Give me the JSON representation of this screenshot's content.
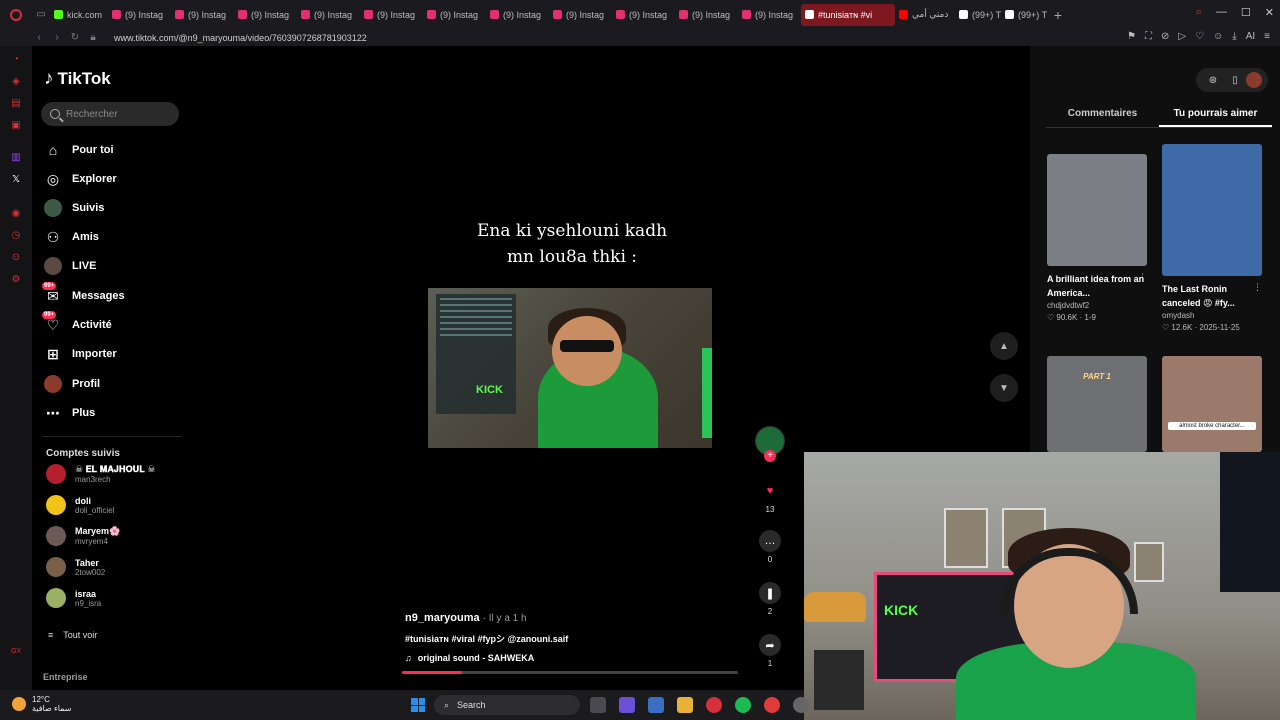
{
  "browser": {
    "tabs": [
      {
        "label": "kick.com",
        "color": "#53fc18",
        "type": "kick"
      },
      {
        "label": "(9) Instag",
        "color": "#e1306c",
        "type": "ig"
      },
      {
        "label": "(9) Instag",
        "color": "#e1306c",
        "type": "ig"
      },
      {
        "label": "(9) Instag",
        "color": "#e1306c",
        "type": "ig"
      },
      {
        "label": "(9) Instag",
        "color": "#e1306c",
        "type": "ig"
      },
      {
        "label": "(9) Instag",
        "color": "#e1306c",
        "type": "ig"
      },
      {
        "label": "(9) Instag",
        "color": "#e1306c",
        "type": "ig"
      },
      {
        "label": "(9) Instag",
        "color": "#e1306c",
        "type": "ig"
      },
      {
        "label": "(9) Instag",
        "color": "#e1306c",
        "type": "ig"
      },
      {
        "label": "(9) Instag",
        "color": "#e1306c",
        "type": "ig"
      },
      {
        "label": "(9) Instag",
        "color": "#e1306c",
        "type": "ig"
      },
      {
        "label": "(9) Instag",
        "color": "#e1306c",
        "type": "ig"
      },
      {
        "label": "#tunisiaᴛɴ #vi",
        "color": "#ffffff",
        "type": "active"
      },
      {
        "label": "دمتي أمي",
        "color": "#ff0000",
        "type": "yt"
      },
      {
        "label": "(99+) TikT",
        "color": "#ffffff",
        "type": "tt"
      },
      {
        "label": "(99+) TikT",
        "color": "#ffffff",
        "type": "tt"
      }
    ],
    "url": "www.tiktok.com/@n9_maryouma/video/7603907268781903122"
  },
  "tiktok": {
    "logo_text": "TikTok",
    "search_placeholder": "Rechercher",
    "nav": {
      "for_you": "Pour toi",
      "explore": "Explorer",
      "following": "Suivis",
      "friends": "Amis",
      "live": "LIVE",
      "messages": "Messages",
      "activity": "Activité",
      "upload": "Importer",
      "profile": "Profil",
      "more": "Plus",
      "badge": "99+"
    },
    "followed_title": "Comptes suivis",
    "followed": [
      {
        "name": "☠ 𝐄𝐋 𝐌𝐀𝐉𝐇𝐎𝐔𝐋 ☠",
        "handle": "man3rech",
        "color": "#b3202b"
      },
      {
        "name": "doli",
        "handle": "doli_officiel",
        "color": "#f0c419"
      },
      {
        "name": "Maryem🌸",
        "handle": "mvryem4",
        "color": "#6b5a55"
      },
      {
        "name": "Taher",
        "handle": "2tow002",
        "color": "#7a6048"
      },
      {
        "name": "israa",
        "handle": "n9_isra",
        "color": "#9ab064"
      }
    ],
    "see_all": "Tout voir",
    "company": "Entreprise"
  },
  "video": {
    "caption_line1": "Ena ki ysehlouni kadh",
    "caption_line2": "mn lou8a thki :",
    "author": "n9_maryouma",
    "time_ago": "· Il y a 1 h",
    "hashtags": "#tunisiaᴛɴ #viral #fypシ @zanouni.saif",
    "sound": "original sound - SAHWEKA",
    "progress": 0.18,
    "likes": "13",
    "comments": "0",
    "saves": "2",
    "shares": "1"
  },
  "right_panel": {
    "tab_comments": "Commentaires",
    "tab_suggested": "Tu pourrais aimer",
    "cards": [
      {
        "title": "A brilliant idea from an America...",
        "user": "chdjdvdtwf2",
        "stats": "♡ 90.6K · 1-9",
        "bg": "#7c7f86"
      },
      {
        "title": "The Last Ronin canceled 😡 #fy...",
        "user": "omydash",
        "stats": "♡ 12.6K · 2025-11-25",
        "bg": "#3e6aa8"
      },
      {
        "title": "",
        "user": "",
        "stats": "",
        "bg": "#6e6f72",
        "label": "PART 1"
      },
      {
        "title": "",
        "user": "",
        "stats": "",
        "bg": "#9b7a6b",
        "label": "almost broke character..."
      }
    ]
  },
  "taskbar": {
    "temp": "12°C",
    "weather": "سماء صافية",
    "search": "Search"
  }
}
